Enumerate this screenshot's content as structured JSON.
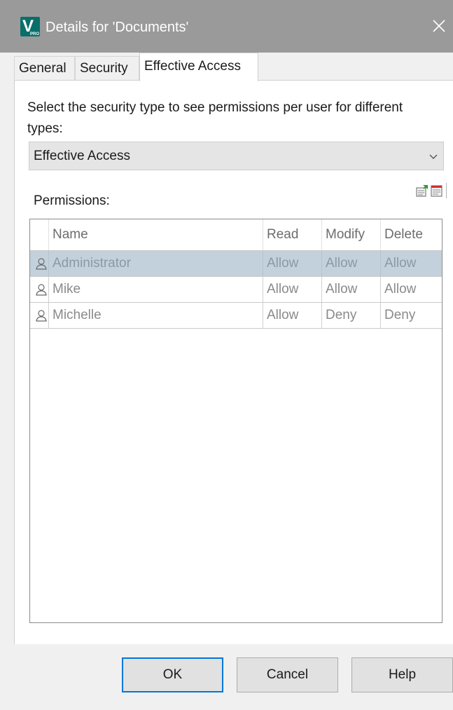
{
  "window": {
    "title": "Details for 'Documents'",
    "app_icon_letter": "V",
    "app_icon_badge": "PRO",
    "accent": "#0078d7"
  },
  "tabs": [
    {
      "label": "General",
      "active": false
    },
    {
      "label": "Security",
      "active": false
    },
    {
      "label": "Effective Access",
      "active": true
    }
  ],
  "panel": {
    "instructions": "Select the security type to see permissions per user for different types:",
    "security_type": {
      "selected": "Effective Access"
    },
    "permissions_label": "Permissions:",
    "toolbar": {
      "icons": [
        "export-icon",
        "report-icon"
      ]
    },
    "grid": {
      "columns": [
        "Name",
        "Read",
        "Modify",
        "Delete"
      ],
      "rows": [
        {
          "name": "Administrator",
          "read": "Allow",
          "modify": "Allow",
          "delete": "Allow",
          "selected": true
        },
        {
          "name": "Mike",
          "read": "Allow",
          "modify": "Allow",
          "delete": "Allow",
          "selected": false
        },
        {
          "name": "Michelle",
          "read": "Allow",
          "modify": "Deny",
          "delete": "Deny",
          "selected": false
        }
      ]
    }
  },
  "buttons": {
    "ok": "OK",
    "cancel": "Cancel",
    "help": "Help"
  }
}
